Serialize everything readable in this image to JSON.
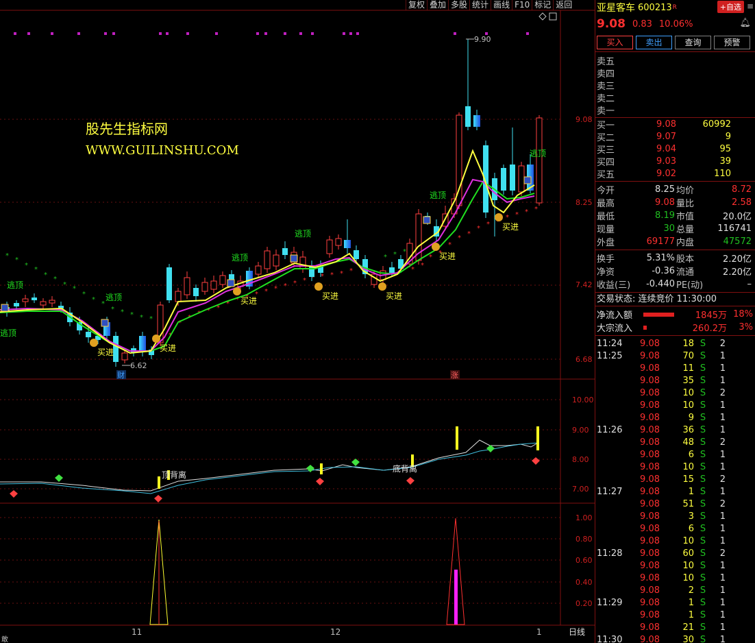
{
  "toolbar": [
    "复权",
    "叠加",
    "多股",
    "统计",
    "画线",
    "F10",
    "标记",
    "返回"
  ],
  "chart": {
    "watermark_cn": "股先生指标网",
    "watermark_url": "WWW.GUILINSHU.COM",
    "price_axis": [
      "9.08",
      "8.25",
      "7.42",
      "6.68"
    ],
    "ind1_axis": [
      "10.00",
      "9.00",
      "8.00",
      "7.00"
    ],
    "ind2_axis": [
      "1.00",
      "0.80",
      "0.60",
      "0.40",
      "0.20"
    ],
    "high_label": "9.90",
    "low_label": "6.62",
    "date_labels": [
      "11",
      "12",
      "1"
    ],
    "period_label": "日线",
    "marker_cai": "财",
    "marker_zhang": "涨",
    "sig_buy": "买进",
    "sig_top": "逃顶",
    "div_top": "顶背离",
    "div_bottom": "底背离",
    "bottom_left_text": "敢"
  },
  "stock": {
    "name": "亚星客车",
    "code": "600213",
    "badge": "R",
    "fav_label": "+自选",
    "price": "9.08",
    "change": "0.83",
    "pct": "10.06%",
    "actions": [
      "买入",
      "卖出",
      "查询",
      "预警"
    ]
  },
  "asks": [
    {
      "label": "卖五",
      "price": "",
      "vol": ""
    },
    {
      "label": "卖四",
      "price": "",
      "vol": ""
    },
    {
      "label": "卖三",
      "price": "",
      "vol": ""
    },
    {
      "label": "卖二",
      "price": "",
      "vol": ""
    },
    {
      "label": "卖一",
      "price": "",
      "vol": ""
    }
  ],
  "bids": [
    {
      "label": "买一",
      "price": "9.08",
      "vol": "60992"
    },
    {
      "label": "买二",
      "price": "9.07",
      "vol": "9"
    },
    {
      "label": "买三",
      "price": "9.04",
      "vol": "95"
    },
    {
      "label": "买四",
      "price": "9.03",
      "vol": "39"
    },
    {
      "label": "买五",
      "price": "9.02",
      "vol": "110"
    }
  ],
  "stats": [
    {
      "k1": "今开",
      "v1": "8.25",
      "c1": "white",
      "k2": "均价",
      "v2": "8.72",
      "c2": "red"
    },
    {
      "k1": "最高",
      "v1": "9.08",
      "c1": "red",
      "k2": "量比",
      "v2": "2.58",
      "c2": "red"
    },
    {
      "k1": "最低",
      "v1": "8.19",
      "c1": "green",
      "k2": "市值",
      "v2": "20.0亿",
      "c2": "white"
    },
    {
      "k1": "现量",
      "v1": "30",
      "c1": "green",
      "k2": "总量",
      "v2": "116741",
      "c2": "white"
    },
    {
      "k1": "外盘",
      "v1": "69177",
      "c1": "red",
      "k2": "内盘",
      "v2": "47572",
      "c2": "green"
    }
  ],
  "stats2": [
    {
      "k1": "换手",
      "v1": "5.31%",
      "c1": "white",
      "k2": "股本",
      "v2": "2.20亿",
      "c2": "white"
    },
    {
      "k1": "净资",
      "v1": "-0.36",
      "c1": "white",
      "k2": "流通",
      "v2": "2.20亿",
      "c2": "white"
    },
    {
      "k1": "收益(三)",
      "v1": "-0.440",
      "c1": "white",
      "k2": "PE(动)",
      "v2": "–",
      "c2": "white"
    }
  ],
  "trade_status": "交易状态: 连续竞价 11:30:00",
  "flows": [
    {
      "label": "净流入额",
      "value": "1845万",
      "pct": "18%",
      "bar": 0.75
    },
    {
      "label": "大宗流入",
      "value": "260.2万",
      "pct": "3%",
      "bar": 0.08
    }
  ],
  "ticks": [
    {
      "time": "11:24",
      "price": "9.08",
      "vol": "18",
      "side": "S",
      "n": "2"
    },
    {
      "time": "11:25",
      "price": "9.08",
      "vol": "70",
      "side": "S",
      "n": "1"
    },
    {
      "time": "",
      "price": "9.08",
      "vol": "11",
      "side": "S",
      "n": "1"
    },
    {
      "time": "",
      "price": "9.08",
      "vol": "35",
      "side": "S",
      "n": "1"
    },
    {
      "time": "",
      "price": "9.08",
      "vol": "10",
      "side": "S",
      "n": "2"
    },
    {
      "time": "",
      "price": "9.08",
      "vol": "10",
      "side": "S",
      "n": "1"
    },
    {
      "time": "",
      "price": "9.08",
      "vol": "9",
      "side": "S",
      "n": "1"
    },
    {
      "time": "11:26",
      "price": "9.08",
      "vol": "36",
      "side": "S",
      "n": "1"
    },
    {
      "time": "",
      "price": "9.08",
      "vol": "48",
      "side": "S",
      "n": "2"
    },
    {
      "time": "",
      "price": "9.08",
      "vol": "6",
      "side": "S",
      "n": "1"
    },
    {
      "time": "",
      "price": "9.08",
      "vol": "10",
      "side": "S",
      "n": "1"
    },
    {
      "time": "",
      "price": "9.08",
      "vol": "15",
      "side": "S",
      "n": "2"
    },
    {
      "time": "11:27",
      "price": "9.08",
      "vol": "1",
      "side": "S",
      "n": "1"
    },
    {
      "time": "",
      "price": "9.08",
      "vol": "51",
      "side": "S",
      "n": "2"
    },
    {
      "time": "",
      "price": "9.08",
      "vol": "3",
      "side": "S",
      "n": "1"
    },
    {
      "time": "",
      "price": "9.08",
      "vol": "6",
      "side": "S",
      "n": "1"
    },
    {
      "time": "",
      "price": "9.08",
      "vol": "10",
      "side": "S",
      "n": "1"
    },
    {
      "time": "11:28",
      "price": "9.08",
      "vol": "60",
      "side": "S",
      "n": "2"
    },
    {
      "time": "",
      "price": "9.08",
      "vol": "10",
      "side": "S",
      "n": "1"
    },
    {
      "time": "",
      "price": "9.08",
      "vol": "10",
      "side": "S",
      "n": "1"
    },
    {
      "time": "",
      "price": "9.08",
      "vol": "2",
      "side": "S",
      "n": "1"
    },
    {
      "time": "11:29",
      "price": "9.08",
      "vol": "1",
      "side": "S",
      "n": "1"
    },
    {
      "time": "",
      "price": "9.08",
      "vol": "1",
      "side": "S",
      "n": "1"
    },
    {
      "time": "",
      "price": "9.08",
      "vol": "21",
      "side": "S",
      "n": "1"
    },
    {
      "time": "11:30",
      "price": "9.08",
      "vol": "30",
      "side": "S",
      "n": "1"
    }
  ]
}
